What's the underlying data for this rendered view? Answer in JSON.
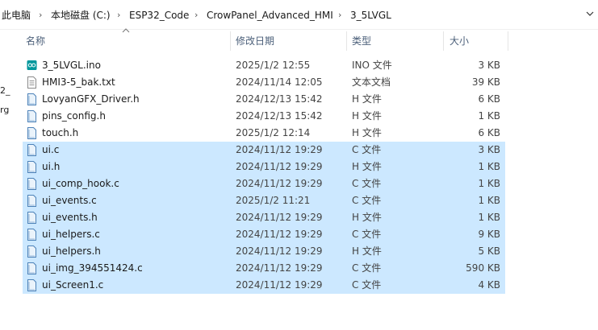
{
  "breadcrumb": [
    "此电脑",
    "本地磁盘 (C:)",
    "ESP32_Code",
    "CrowPanel_Advanced_HMI",
    "3_5LVGL"
  ],
  "columns": {
    "name": "名称",
    "date": "修改日期",
    "type": "类型",
    "size": "大小"
  },
  "left_pane_fragments": [
    "2_",
    "rg"
  ],
  "files": [
    {
      "name": "3_5LVGL.ino",
      "date": "2025/1/2 12:55",
      "type": "INO 文件",
      "size": "3 KB",
      "icon": "arduino-file-icon",
      "selected": false
    },
    {
      "name": "HMI3-5_bak.txt",
      "date": "2024/11/14 12:05",
      "type": "文本文档",
      "size": "39 KB",
      "icon": "text-file-icon",
      "selected": false
    },
    {
      "name": "LovyanGFX_Driver.h",
      "date": "2024/12/13 15:42",
      "type": "H 文件",
      "size": "6 KB",
      "icon": "source-file-icon",
      "selected": false
    },
    {
      "name": "pins_config.h",
      "date": "2024/12/13 15:42",
      "type": "H 文件",
      "size": "1 KB",
      "icon": "source-file-icon",
      "selected": false
    },
    {
      "name": "touch.h",
      "date": "2025/1/2 12:14",
      "type": "H 文件",
      "size": "6 KB",
      "icon": "source-file-icon",
      "selected": false
    },
    {
      "name": "ui.c",
      "date": "2024/11/12 19:29",
      "type": "C 文件",
      "size": "3 KB",
      "icon": "source-file-icon",
      "selected": true
    },
    {
      "name": "ui.h",
      "date": "2024/11/12 19:29",
      "type": "H 文件",
      "size": "1 KB",
      "icon": "source-file-icon",
      "selected": true
    },
    {
      "name": "ui_comp_hook.c",
      "date": "2024/11/12 19:29",
      "type": "C 文件",
      "size": "1 KB",
      "icon": "source-file-icon",
      "selected": true
    },
    {
      "name": "ui_events.c",
      "date": "2025/1/2 11:21",
      "type": "C 文件",
      "size": "1 KB",
      "icon": "source-file-icon",
      "selected": true
    },
    {
      "name": "ui_events.h",
      "date": "2024/11/12 19:29",
      "type": "H 文件",
      "size": "1 KB",
      "icon": "source-file-icon",
      "selected": true
    },
    {
      "name": "ui_helpers.c",
      "date": "2024/11/12 19:29",
      "type": "C 文件",
      "size": "9 KB",
      "icon": "source-file-icon",
      "selected": true
    },
    {
      "name": "ui_helpers.h",
      "date": "2024/11/12 19:29",
      "type": "H 文件",
      "size": "5 KB",
      "icon": "source-file-icon",
      "selected": true
    },
    {
      "name": "ui_img_394551424.c",
      "date": "2024/11/12 19:29",
      "type": "C 文件",
      "size": "590 KB",
      "icon": "source-file-icon",
      "selected": true
    },
    {
      "name": "ui_Screen1.c",
      "date": "2024/11/12 19:29",
      "type": "C 文件",
      "size": "4 KB",
      "icon": "source-file-icon",
      "selected": true
    }
  ],
  "colors": {
    "selection": "#cce8ff",
    "header_text": "#4c607a",
    "arduino_teal": "#00979c"
  }
}
